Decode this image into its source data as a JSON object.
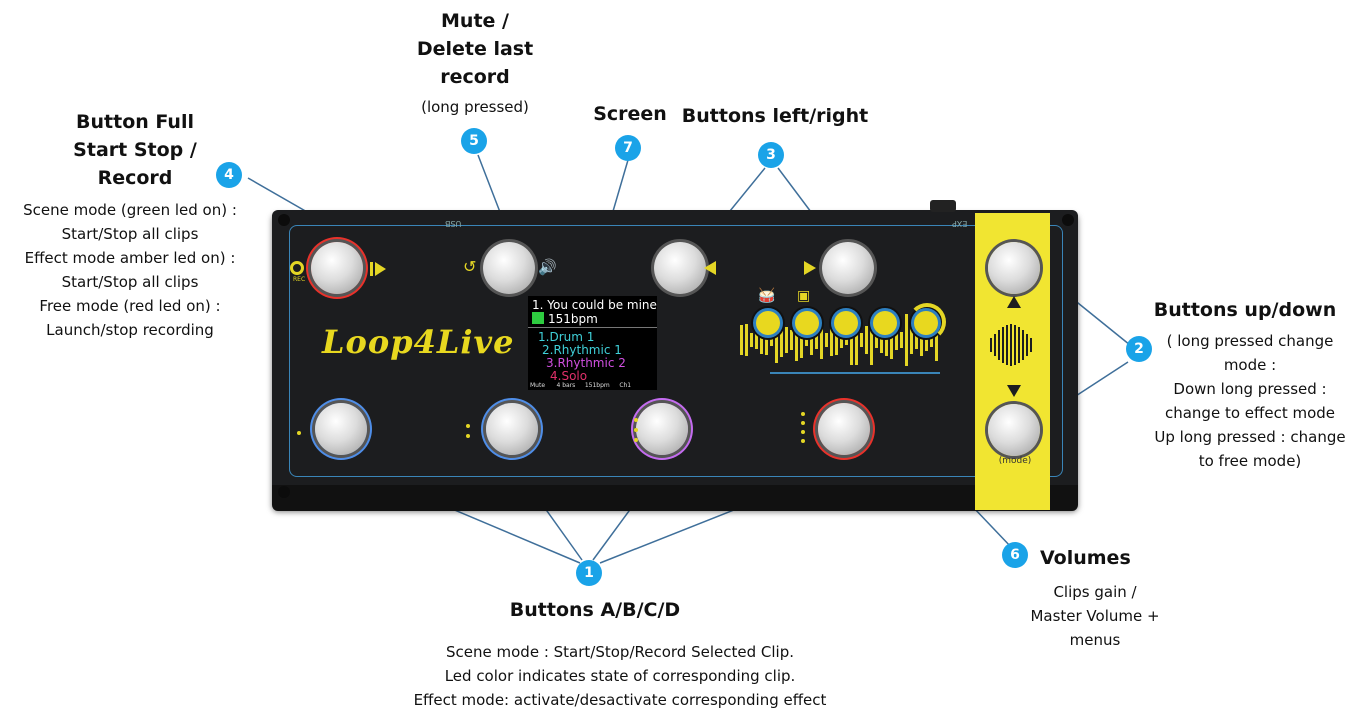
{
  "callouts": {
    "c1": {
      "badge": "1",
      "title": "Buttons A/B/C/D",
      "desc": [
        "Scene mode : Start/Stop/Record Selected  Clip.",
        "Led color indicates state of corresponding clip.",
        "Effect mode: activate/desactivate corresponding effect"
      ]
    },
    "c2": {
      "badge": "2",
      "title": "Buttons up/down",
      "desc": [
        "( long pressed change",
        "mode :",
        "Down long pressed :",
        "change to effect mode",
        "Up long pressed : change",
        "to free mode)"
      ]
    },
    "c3": {
      "badge": "3",
      "title": "Buttons left/right"
    },
    "c4": {
      "badge": "4",
      "title": [
        "Button Full",
        "Start Stop /",
        "Record"
      ],
      "desc": [
        "Scene mode (green led on) :",
        "Start/Stop all clips",
        "Effect mode amber led on) :",
        "Start/Stop all clips",
        "Free mode (red led on) :",
        "Launch/stop recording"
      ]
    },
    "c5": {
      "badge": "5",
      "title": [
        "Mute /",
        "Delete last",
        "record"
      ],
      "desc": "(long pressed)"
    },
    "c6": {
      "badge": "6",
      "title": "Volumes",
      "desc": [
        "Clips gain /",
        "Master Volume +",
        "menus"
      ]
    },
    "c7": {
      "badge": "7",
      "title": "Screen"
    }
  },
  "device": {
    "logo": "Loop4Live",
    "label_usb": "USB",
    "label_exp": "EXP",
    "label_rec": "REC",
    "label_mode": "(mode)",
    "colors": {
      "body": "#1c1d1f",
      "accent_yellow": "#f1e531",
      "line_blue": "#3a85b8",
      "badge_blue": "#1aa3e8"
    },
    "rings": {
      "full": "#e8322b",
      "a": "#4f8ee8",
      "b": "#4f8ee8",
      "c": "#c46cf0",
      "d": "#e8322b"
    },
    "screen": {
      "line1": "1. You could be mine",
      "line2": "151bpm",
      "tracks": [
        {
          "text": "1.Drum 1",
          "color": "#3fd0d8"
        },
        {
          "text": "2.Rhythmic 1",
          "color": "#3fd0d8"
        },
        {
          "text": "3.Rhythmic 2",
          "color": "#d04fe0"
        },
        {
          "text": "4.Solo",
          "color": "#e0306a"
        }
      ],
      "status": [
        "Mute",
        "4 bars",
        "151bpm",
        "Ch1"
      ]
    }
  }
}
